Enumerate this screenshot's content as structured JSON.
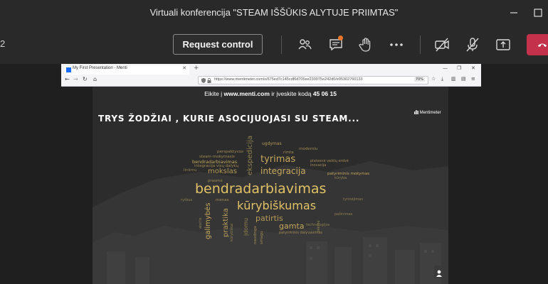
{
  "window": {
    "title": "Virtuali konferencija \"STEAM IŠŠŪKIS ALYTUJE PRIIMTAS\""
  },
  "toolbar": {
    "counter": "2",
    "request_control": "Request control",
    "icons": [
      "people-icon",
      "chat-icon",
      "raise-hand-icon",
      "more-icon",
      "camera-off-icon",
      "mic-off-icon",
      "share-icon",
      "hangup-icon"
    ],
    "accent": "#c4314b"
  },
  "browser": {
    "tab_title": "My First Presentation - Menti",
    "url": "https://www.mentimeter.com/s/675ed7c145cdf6d705ee230075e242d0/e95302760133",
    "zoom": "70%"
  },
  "slide": {
    "join_prefix": "Eikite į ",
    "join_site": "www.menti.com",
    "join_middle": " ir įveskite kodą ",
    "join_code": "45 06 15",
    "title": "TRYS ŽODŽIAI , KURIE ASOCIJUOJASI SU STEAM...",
    "brand": "Mentimeter",
    "words": {
      "bendradarbiavimas": "bendradarbiavimas",
      "kurybiskumas": "kūrybiškumas",
      "integracija": "integracija",
      "tyrimas": "tyrimas",
      "mokslas": "mokslas",
      "ekspedicija": "ekspedicija",
      "galimybes": "galimybės",
      "praktika": "praktika",
      "patirtis": "patirtis",
      "gamta": "gamta",
      "ugdymas": "ugdymas",
      "rimta": "rimta",
      "moderniu": "moderniu",
      "perspektyvos": "perspektyvos",
      "steam_mokymasis": "steam mokymasis",
      "bendradarbiavimas_small": "bendradarbiavimas",
      "integracija_visu": "integracija visų dalykų",
      "linkmu": "linkmu",
      "plates_veiklos": "platesnė veiklų erdvė",
      "inovacija": "inovacija",
      "patyriminis_mokymas": "patyriminis mokymas",
      "kuryba": "kūryba",
      "prasme": "prasmė",
      "menas": "menas",
      "ryskus": "ryškus",
      "tyrinejimas": "tyrinėjimas",
      "pazinimas": "pažinimas",
      "technologijos": "technologijos",
      "patyriminis_dalyvavimas": "patyriminis dalyvavimas",
      "idomu": "įdomu",
      "naudinga": "naudinga",
      "smagu": "smagu",
      "kurybiskai": "kūrybiškai",
      "ateitis": "ateitis",
      "sekme": "sėkmė"
    },
    "word_colors": {
      "big": "#e3c266",
      "mid": "#c6a85c",
      "small": "#b59a58"
    }
  }
}
